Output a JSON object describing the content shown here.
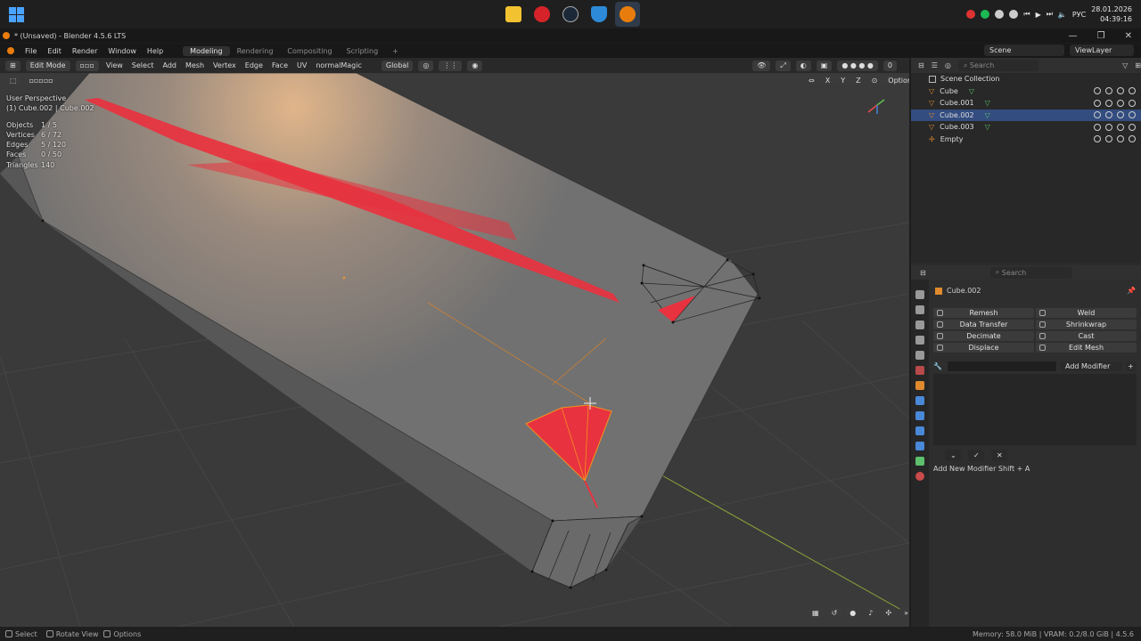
{
  "taskbar": {
    "tray_lang": "РУС",
    "date": "28.01.2026",
    "time": "04:39:16",
    "apps": [
      "file-explorer-icon",
      "vivaldi-icon",
      "steam-icon",
      "security-icon",
      "blender-icon"
    ]
  },
  "window": {
    "title": "* (Unsaved) - Blender 4.5.6 LTS",
    "minimize": "—",
    "maximize": "❐",
    "close": "✕"
  },
  "menubar": {
    "items": [
      "File",
      "Edit",
      "Render",
      "Window",
      "Help"
    ],
    "workspaces": [
      "Modeling",
      "Rendering",
      "Compositing",
      "Scripting"
    ],
    "add_ws": "+",
    "scene": "Scene",
    "view_layer": "ViewLayer"
  },
  "viewport": {
    "mode": "Edit Mode",
    "menus": [
      "View",
      "Select",
      "Add",
      "Mesh",
      "Vertex",
      "Edge",
      "Face",
      "UV",
      "normalMagic"
    ],
    "orientation": "Global",
    "options": "Options",
    "axes": [
      "X",
      "Y",
      "Z"
    ],
    "overlay_count": "0",
    "perspective": "User Perspective",
    "object_label": "(1) Cube.002 | Cube.002",
    "stats": [
      {
        "k": "Objects",
        "v": "1 / 5"
      },
      {
        "k": "Vertices",
        "v": "6 / 72"
      },
      {
        "k": "Edges",
        "v": "5 / 120"
      },
      {
        "k": "Faces",
        "v": "0 / 50"
      },
      {
        "k": "Triangles",
        "v": "140"
      }
    ]
  },
  "outliner": {
    "search_placeholder": "Search",
    "collection": "Scene Collection",
    "items": [
      {
        "name": "Cube",
        "selected": false
      },
      {
        "name": "Cube.001",
        "selected": false
      },
      {
        "name": "Cube.002",
        "selected": true
      },
      {
        "name": "Cube.003",
        "selected": false
      },
      {
        "name": "Empty",
        "selected": false
      }
    ]
  },
  "properties": {
    "search_placeholder": "Search",
    "object": "Cube.002",
    "modifiers": [
      [
        "Remesh",
        "Weld"
      ],
      [
        "Data Transfer",
        "Shrinkwrap"
      ],
      [
        "Decimate",
        "Cast"
      ],
      [
        "Displace",
        "Edit Mesh"
      ]
    ],
    "add_modifier": "Add Modifier",
    "hint": "Add New Modifier Shift + A"
  },
  "statusbar": {
    "select": "Select",
    "rotate": "Rotate View",
    "options": "Options",
    "memory": "Memory: 58.0 MiB | VRAM: 0.2/8.0 GiB | 4.5.6"
  }
}
